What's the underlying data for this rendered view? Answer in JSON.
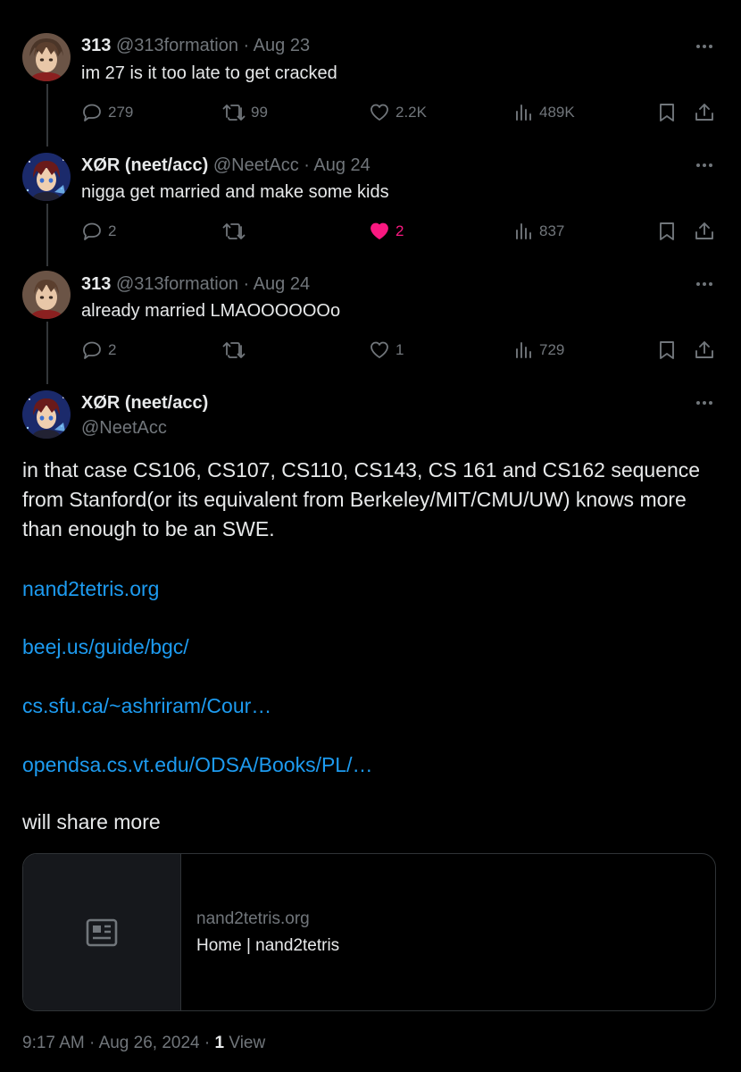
{
  "thread": [
    {
      "name": "313",
      "handle": "@313formation",
      "sep": "·",
      "date": "Aug 23",
      "text": "im 27 is it too late to get cracked",
      "replies": "279",
      "retweets": "99",
      "likes": "2.2K",
      "views": "489K",
      "liked": false
    },
    {
      "name": "XØR (neet/acc)",
      "handle": "@NeetAcc",
      "sep": "·",
      "date": "Aug 24",
      "text": "nigga get married and make some kids",
      "replies": "2",
      "retweets": "",
      "likes": "2",
      "views": "837",
      "liked": true
    },
    {
      "name": "313",
      "handle": "@313formation",
      "sep": "·",
      "date": "Aug 24",
      "text": "already married LMAOOOOOOo",
      "replies": "2",
      "retweets": "",
      "likes": "1",
      "views": "729",
      "liked": false
    }
  ],
  "main": {
    "name": "XØR (neet/acc)",
    "handle": "@NeetAcc",
    "body": "in that case CS106, CS107, CS110, CS143, CS 161 and CS162 sequence from Stanford(or its equivalent from Berkeley/MIT/CMU/UW) knows more than enough to be an SWE.",
    "links": [
      "nand2tetris.org",
      "beej.us/guide/bgc/",
      "cs.sfu.ca/~ashriram/Cour…",
      "opendsa.cs.vt.edu/ODSA/Books/PL/…"
    ],
    "closing": "will share more",
    "card": {
      "domain": "nand2tetris.org",
      "title": "Home | nand2tetris"
    },
    "footer": {
      "time": "9:17 AM",
      "sep": "·",
      "date": "Aug 26, 2024",
      "sep2": "·",
      "views_count": "1",
      "views_label": "View"
    }
  },
  "icons": {
    "more": "more-horizontal-icon",
    "reply": "reply-icon",
    "retweet": "retweet-icon",
    "like": "heart-icon",
    "views": "views-chart-icon",
    "bookmark": "bookmark-icon",
    "share": "share-icon",
    "card": "article-card-icon"
  },
  "colors": {
    "background": "#000000",
    "text": "#e7e9ea",
    "muted": "#71767b",
    "link": "#1d9bf0",
    "like_active": "#f91880",
    "border": "#2f3336"
  }
}
